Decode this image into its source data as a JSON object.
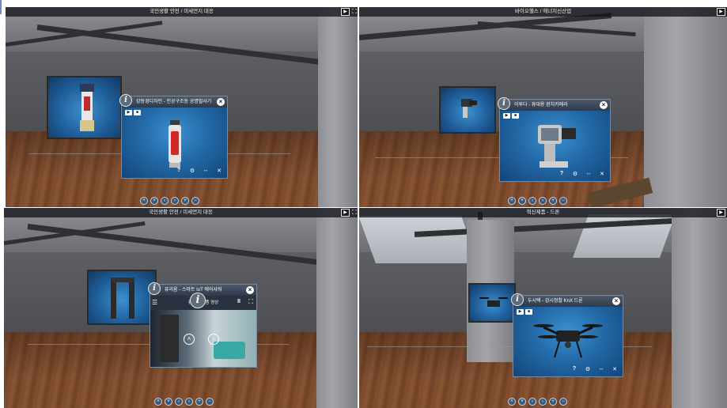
{
  "panels": [
    {
      "title": "국민생활 안전 / 미세먼지 대응",
      "play_label": "▶",
      "expand_label": "⛶",
      "popup": {
        "title": "강동경디자인 - 인공구조동 공명벌사기",
        "tools": [
          "?",
          "⚙",
          "↔",
          "✕"
        ]
      },
      "nav_icons": [
        "˄",
        "˅",
        "‹",
        "›",
        "+",
        "−"
      ]
    },
    {
      "title": "바이오헬스 / 에너지신산업",
      "play_label": "▶",
      "popup": {
        "title": "이루다 - 휴대용 완치카메라",
        "tools": [
          "?",
          "⚙",
          "↔",
          "✕"
        ]
      },
      "nav_icons": [
        "˄",
        "˅",
        "‹",
        "›",
        "+",
        "−"
      ]
    },
    {
      "title": "국민생활 안전 / 미세먼지 대응",
      "play_label": "▶",
      "expand_label": "⛶",
      "popup": {
        "title": "퓨리움 - 스마트 IoT 에어샤워",
        "subtitle": "퓨리움 제품 영상",
        "pause_label": "II",
        "tools": []
      },
      "nav_icons": [
        "˄",
        "˅",
        "‹",
        "›",
        "+",
        "−"
      ]
    },
    {
      "title": "혁신제품 - 드론",
      "play_label": "▶",
      "popup": {
        "title": "두시텍 - 감시정찰 KnX 드론",
        "tools": [
          "?",
          "⚙",
          "↔",
          "✕"
        ]
      },
      "nav_icons": [
        "˄",
        "˅",
        "‹",
        "›",
        "+",
        "−"
      ]
    }
  ],
  "colors": {
    "popup_blue": "#236aa8",
    "header_dark": "#2f3a49",
    "floor_wood": "#7a4a2e"
  }
}
